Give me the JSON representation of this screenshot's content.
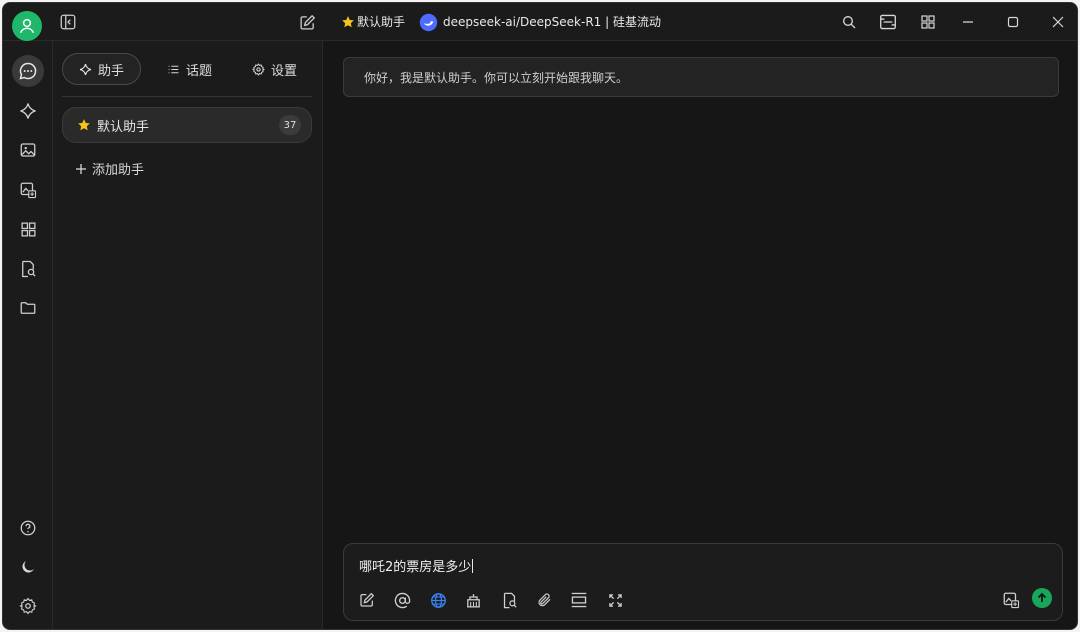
{
  "titlebar": {
    "assistant_name": "默认助手",
    "model_label": "deepseek-ai/DeepSeek-R1 | 硅基流动"
  },
  "rail": {
    "items": [
      "chat",
      "sparkle",
      "image",
      "image-edit",
      "apps",
      "doc-search",
      "folder"
    ],
    "bottom": [
      "help",
      "theme",
      "settings"
    ]
  },
  "panel": {
    "tabs": [
      {
        "label": "助手",
        "icon": "sparkle-icon",
        "active": true
      },
      {
        "label": "话题",
        "icon": "list-icon",
        "active": false
      },
      {
        "label": "设置",
        "icon": "gear-icon",
        "active": false
      }
    ],
    "assistant": {
      "name": "默认助手",
      "count": "37"
    },
    "add_label": "添加助手"
  },
  "chat": {
    "greeting": "你好，我是默认助手。你可以立刻开始跟我聊天。",
    "input_value": "哪吒2的票房是多少"
  },
  "colors": {
    "accent": "#1fb86a",
    "send": "#19a65a",
    "web_search_active": "#3b82f6"
  }
}
